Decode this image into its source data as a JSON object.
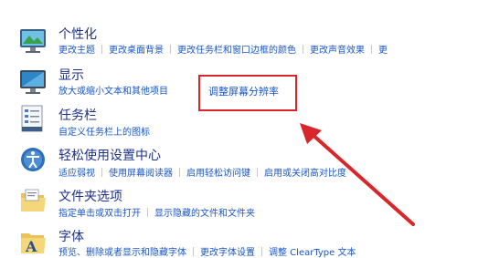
{
  "sections": [
    {
      "title": "个性化",
      "icon": "personalization-monitor-icon",
      "links": [
        "更改主题",
        "更改桌面背景",
        "更改任务栏和窗口边框的颜色",
        "更改声音效果",
        "更"
      ]
    },
    {
      "title": "显示",
      "icon": "display-monitor-icon",
      "links": [
        "放大或缩小文本和其他项目"
      ]
    },
    {
      "title": "任务栏",
      "icon": "taskbar-icon",
      "links": [
        "自定义任务栏上的图标"
      ]
    },
    {
      "title": "轻松使用设置中心",
      "icon": "ease-of-access-icon",
      "links": [
        "适应弱视",
        "使用屏幕阅读器",
        "启用轻松访问键",
        "启用或关闭高对比度"
      ]
    },
    {
      "title": "文件夹选项",
      "icon": "folder-options-icon",
      "links": [
        "指定单击或双击打开",
        "显示隐藏的文件和文件夹"
      ]
    },
    {
      "title": "字体",
      "icon": "fonts-icon",
      "links": [
        "预览、删除或者显示和隐藏字体",
        "更改字体设置",
        "调整 ClearType 文本"
      ]
    }
  ],
  "highlighted_link": "调整屏幕分辨率",
  "colors": {
    "title": "#1e3287",
    "link": "#1a56c4",
    "annotation": "#d9262a"
  }
}
